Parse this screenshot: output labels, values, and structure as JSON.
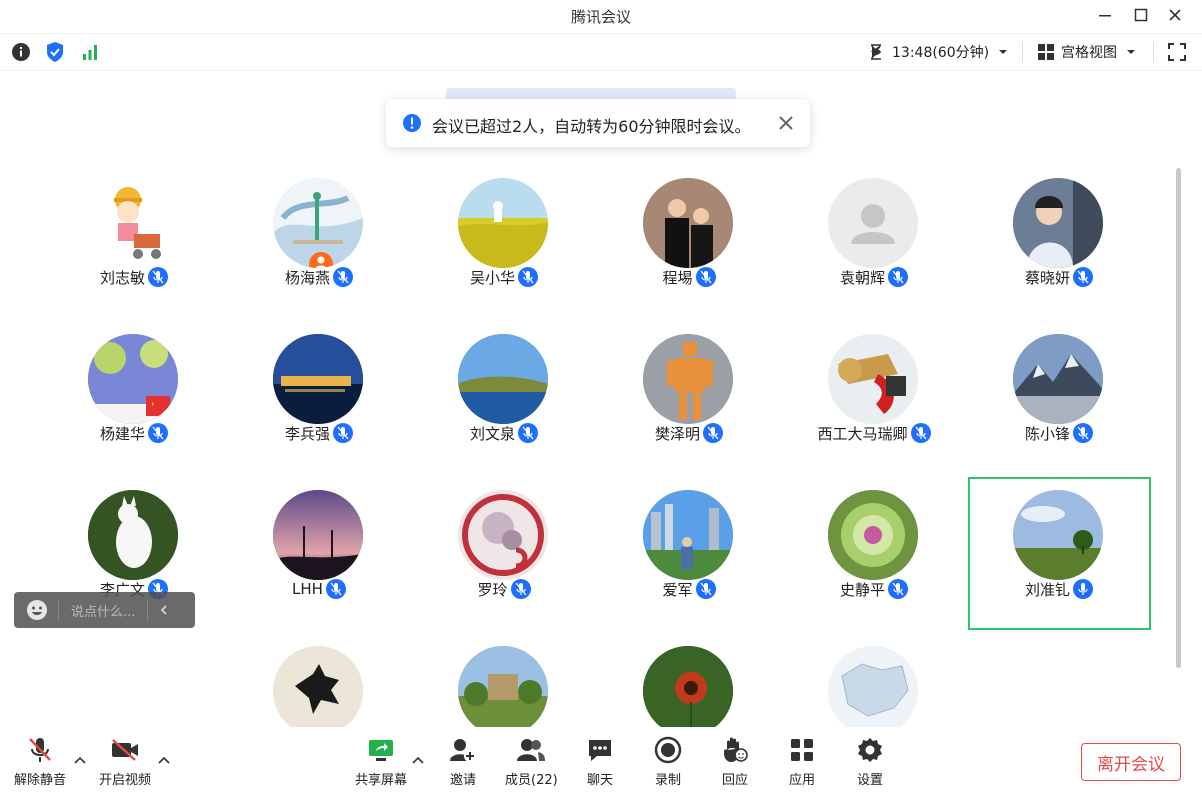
{
  "window": {
    "title": "腾讯会议"
  },
  "infobar": {
    "timer": "13:48(60分钟)",
    "view_label": "宫格视图"
  },
  "notice": {
    "text": "会议已超过2人，自动转为60分钟限时会议。"
  },
  "participants": [
    {
      "name": "刘志敏"
    },
    {
      "name": "杨海燕"
    },
    {
      "name": "吴小华"
    },
    {
      "name": "程埸"
    },
    {
      "name": "袁朝辉"
    },
    {
      "name": "蔡晓妍"
    },
    {
      "name": "杨建华"
    },
    {
      "name": "李兵强"
    },
    {
      "name": "刘文泉"
    },
    {
      "name": "樊泽明"
    },
    {
      "name": "西工大马瑞卿"
    },
    {
      "name": "陈小锋"
    },
    {
      "name": "李广文"
    },
    {
      "name": "LHH"
    },
    {
      "name": "罗玲"
    },
    {
      "name": "爱军"
    },
    {
      "name": "史静平"
    },
    {
      "name": "刘准钆"
    }
  ],
  "chat": {
    "placeholder": "说点什么..."
  },
  "toolbar": {
    "unmute": "解除静音",
    "start_video": "开启视频",
    "share": "共享屏幕",
    "invite": "邀请",
    "members": "成员(22)",
    "chat": "聊天",
    "record": "录制",
    "react": "回应",
    "apps": "应用",
    "settings": "设置",
    "leave": "离开会议"
  },
  "colors": {
    "accent": "#1e6fff",
    "speaking_border": "#2ec46f",
    "danger": "#e24a4a",
    "signal": "#22b14c"
  }
}
